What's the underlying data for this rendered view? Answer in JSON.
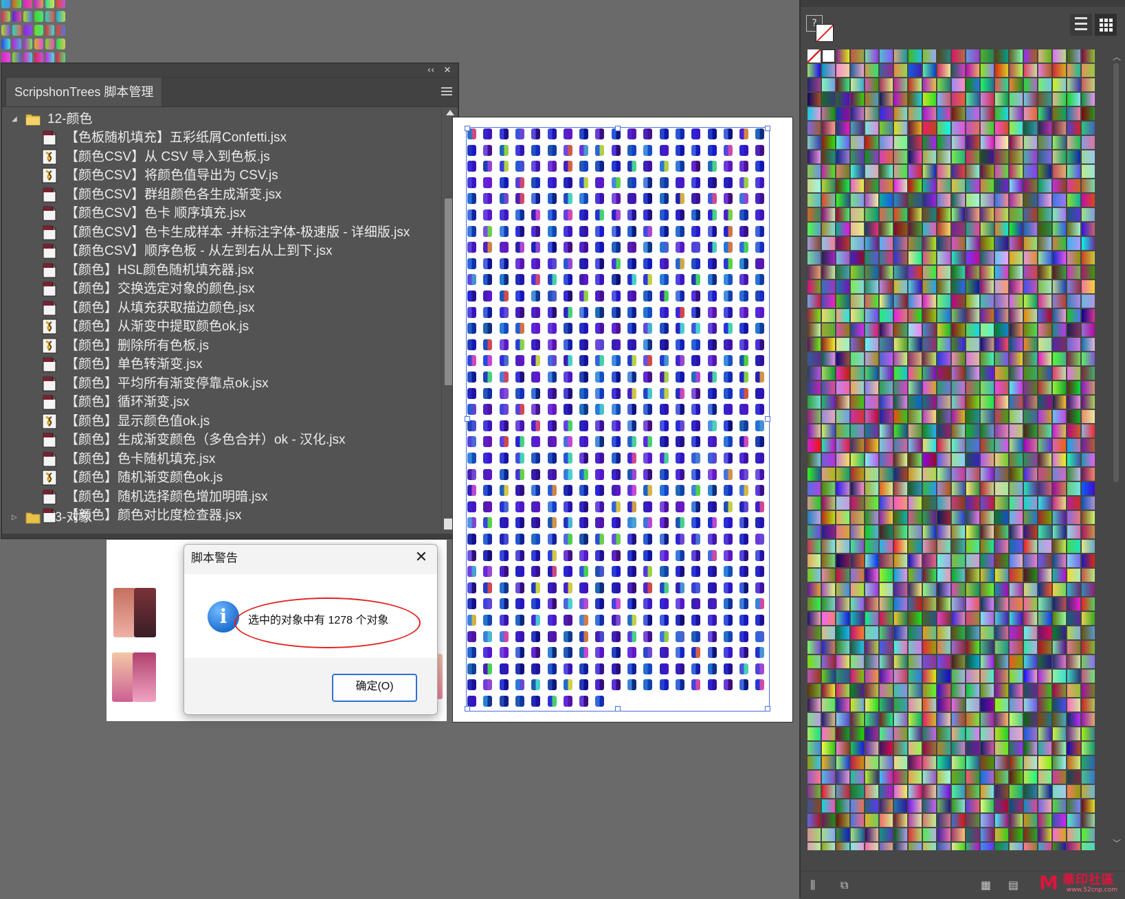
{
  "script_panel": {
    "title": "ScripshonTrees 脚本管理",
    "collapse_glyph": "‹‹",
    "close_glyph": "✕",
    "folder": "12-颜色",
    "next_folder_partial": "13-对象",
    "items": [
      {
        "label": "【色板随机填充】五彩纸屑Confetti.jsx",
        "type": "jsx"
      },
      {
        "label": "【颜色CSV】从 CSV 导入到色板.js",
        "type": "js"
      },
      {
        "label": "【颜色CSV】将颜色值导出为 CSV.js",
        "type": "js"
      },
      {
        "label": "【颜色CSV】群组颜色各生成渐变.jsx",
        "type": "jsx"
      },
      {
        "label": "【颜色CSV】色卡 顺序填充.jsx",
        "type": "jsx"
      },
      {
        "label": "【颜色CSV】色卡生成样本 -并标注字体-极速版 - 详细版.jsx",
        "type": "jsx"
      },
      {
        "label": "【颜色CSV】顺序色板 - 从左到右从上到下.jsx",
        "type": "jsx"
      },
      {
        "label": "【颜色】HSL颜色随机填充器.jsx",
        "type": "jsx"
      },
      {
        "label": "【颜色】交换选定对象的颜色.jsx",
        "type": "jsx"
      },
      {
        "label": "【颜色】从填充获取描边颜色.jsx",
        "type": "jsx"
      },
      {
        "label": "【颜色】从渐变中提取颜色ok.js",
        "type": "js"
      },
      {
        "label": "【颜色】删除所有色板.js",
        "type": "js"
      },
      {
        "label": "【颜色】单色转渐变.jsx",
        "type": "jsx"
      },
      {
        "label": "【颜色】平均所有渐变停靠点ok.jsx",
        "type": "jsx"
      },
      {
        "label": "【颜色】循环渐变.jsx",
        "type": "jsx"
      },
      {
        "label": "【颜色】显示颜色值ok.js",
        "type": "js"
      },
      {
        "label": "【颜色】生成渐变颜色（多色合并）ok - 汉化.jsx",
        "type": "jsx"
      },
      {
        "label": "【颜色】色卡随机填充.jsx",
        "type": "jsx"
      },
      {
        "label": "【颜色】随机渐变颜色ok.js",
        "type": "js"
      },
      {
        "label": "【颜色】随机选择颜色增加明暗.jsx",
        "type": "jsx"
      },
      {
        "label": "【颜色】颜色对比度检查器.jsx",
        "type": "jsx"
      }
    ]
  },
  "dialog": {
    "title": "脚本警告",
    "close_glyph": "✕",
    "info_glyph": "i",
    "message": "选中的对象中有 1278 个对象",
    "ok_label": "确定(O)"
  },
  "swatches_panel": {
    "help_glyph": "?",
    "view_list_icon": "list-view-icon",
    "view_grid_icon": "grid-view-icon"
  },
  "watermark": {
    "text": "華印社區",
    "sub": "www.52cnp.com",
    "logo": "M"
  },
  "colors": {
    "panel_bg": "#535353",
    "canvas_bg": "#6a6a6a",
    "selection": "#4b6ede",
    "highlight": "#e02020",
    "accent": "#2f6fd6"
  }
}
